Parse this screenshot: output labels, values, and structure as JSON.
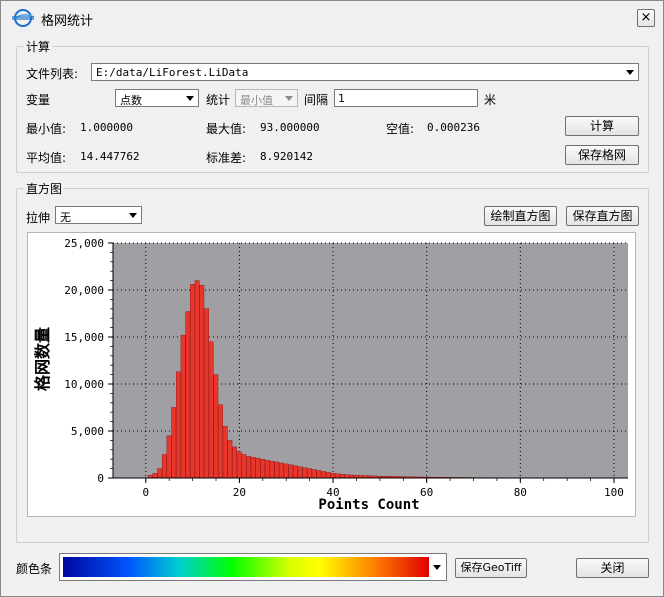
{
  "window": {
    "title": "格网统计",
    "close_glyph": "×"
  },
  "calc": {
    "group_title": "计算",
    "file_list_label": "文件列表:",
    "file_list_value": "E:/data/LiForest.LiData",
    "variable_label": "变量",
    "variable_value": "点数",
    "stat_label": "统计",
    "stat_value": "最小值",
    "interval_label": "间隔",
    "interval_value": "1",
    "interval_unit": "米",
    "min_label": "最小值:",
    "min_value": "1.000000",
    "max_label": "最大值:",
    "max_value": "93.000000",
    "null_label": "空值:",
    "null_value": "0.000236",
    "mean_label": "平均值:",
    "mean_value": "14.447762",
    "std_label": "标准差:",
    "std_value": "8.920142",
    "compute_button": "计算",
    "save_grid_button": "保存格网"
  },
  "histogram": {
    "group_title": "直方图",
    "stretch_label": "拉伸",
    "stretch_value": "无",
    "draw_button": "绘制直方图",
    "save_button": "保存直方图"
  },
  "footer": {
    "colorbar_label": "颜色条",
    "save_geotiff_button": "保存GeoTiff",
    "close_button": "关闭"
  },
  "colors": {
    "bar_fill": "#e8362c",
    "bar_edge": "#8a1010",
    "plot_bg": "#a0a0a4"
  },
  "chart_data": {
    "type": "bar",
    "xlabel": "Points Count",
    "ylabel": "格网数量",
    "xlim": [
      0,
      100
    ],
    "ylim": [
      0,
      25000
    ],
    "xticks": [
      0,
      20,
      40,
      60,
      80,
      100
    ],
    "yticks": [
      0,
      5000,
      10000,
      15000,
      20000,
      25000
    ],
    "ytick_labels": [
      "0",
      "5,000",
      "10,000",
      "15,000",
      "20,000",
      "25,000"
    ],
    "grid": true,
    "x": [
      1,
      2,
      3,
      4,
      5,
      6,
      7,
      8,
      9,
      10,
      11,
      12,
      13,
      14,
      15,
      16,
      17,
      18,
      19,
      20,
      21,
      22,
      23,
      24,
      25,
      26,
      27,
      28,
      29,
      30,
      31,
      32,
      33,
      34,
      35,
      36,
      37,
      38,
      39,
      40,
      41,
      42,
      43,
      44,
      45,
      46,
      47,
      48,
      49,
      50,
      51,
      52,
      53,
      54,
      55,
      56,
      57,
      58,
      59,
      60,
      61,
      62,
      63,
      64,
      65,
      66,
      67,
      68,
      69,
      70,
      71,
      72,
      73,
      74,
      75,
      76,
      77,
      78,
      79,
      80,
      81,
      82,
      83,
      84,
      85,
      86,
      87,
      88,
      89,
      90,
      91,
      92,
      93
    ],
    "values": [
      300,
      500,
      1000,
      2500,
      4500,
      7500,
      11300,
      15200,
      17700,
      20600,
      21000,
      20500,
      18000,
      14500,
      11000,
      7800,
      5500,
      4000,
      3300,
      2800,
      2500,
      2300,
      2200,
      2100,
      2000,
      1900,
      1800,
      1700,
      1600,
      1500,
      1400,
      1300,
      1200,
      1100,
      1000,
      900,
      800,
      700,
      600,
      500,
      450,
      400,
      350,
      320,
      300,
      280,
      260,
      240,
      220,
      200,
      190,
      180,
      170,
      160,
      150,
      140,
      130,
      120,
      110,
      100,
      90,
      80,
      75,
      70,
      65,
      60,
      55,
      50,
      45,
      40,
      38,
      36,
      34,
      32,
      30,
      28,
      26,
      24,
      22,
      20,
      18,
      16,
      14,
      12,
      10,
      9,
      8,
      7,
      6,
      5,
      4,
      3,
      2
    ]
  }
}
